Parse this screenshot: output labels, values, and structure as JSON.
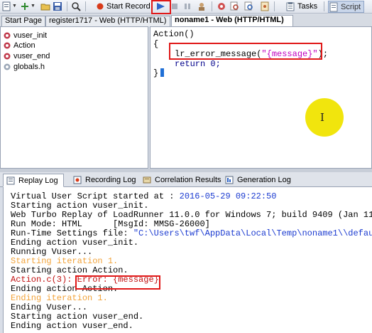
{
  "toolbar": {
    "start_record_label": "Start Record",
    "tasks_label": "Tasks",
    "script_label": "Script"
  },
  "editor_tabs": [
    {
      "label": "Start Page"
    },
    {
      "label": "register1717 - Web (HTTP/HTML)"
    },
    {
      "label": "noname1 - Web (HTTP/HTML)"
    }
  ],
  "tree": {
    "items": [
      {
        "label": "vuser_init"
      },
      {
        "label": "Action"
      },
      {
        "label": "vuser_end"
      },
      {
        "label": "globals.h"
      }
    ]
  },
  "editor": {
    "lines": [
      "Action()",
      "{",
      "lr_error_message(",
      "\"{message}\"",
      ");",
      "return 0;",
      "}"
    ]
  },
  "output_tabs": [
    {
      "label": "Replay Log"
    },
    {
      "label": "Recording Log"
    },
    {
      "label": "Correlation Results"
    },
    {
      "label": "Generation Log"
    }
  ],
  "log": {
    "lines": [
      {
        "text": "Virtual User Script started at : ",
        "value": "2016-05-29 09:22:50"
      },
      {
        "text": "Starting action vuser_init."
      },
      {
        "text": "Web Turbo Replay of LoadRunner 11.0.0 for Windows 7; build 9409 (Jan 11"
      },
      {
        "text": "Run Mode: HTML      [MsgId: MMSG-26000]"
      },
      {
        "text": "Run-Time Settings file: ",
        "value": "\"C:\\Users\\twf\\AppData\\Local\\Temp\\noname1\\\\defaul"
      },
      {
        "text": "Ending action vuser_init."
      },
      {
        "text": "Running Vuser..."
      },
      {
        "text": "Starting iteration 1."
      },
      {
        "text": "Starting action Action."
      },
      {
        "text": "Action.c(3): ",
        "value": "Error: {message}"
      },
      {
        "text": "Ending action Action."
      },
      {
        "text": "Ending iteration 1."
      },
      {
        "text": "Ending Vuser..."
      },
      {
        "text": "Starting action vuser_end."
      },
      {
        "text": "Ending action vuser_end."
      }
    ]
  },
  "colors": {
    "highlight_red": "#e01818",
    "log_warning_orange": "#f2a33a",
    "log_error_red": "#c01010",
    "pointer_yellow": "#f0e400"
  }
}
